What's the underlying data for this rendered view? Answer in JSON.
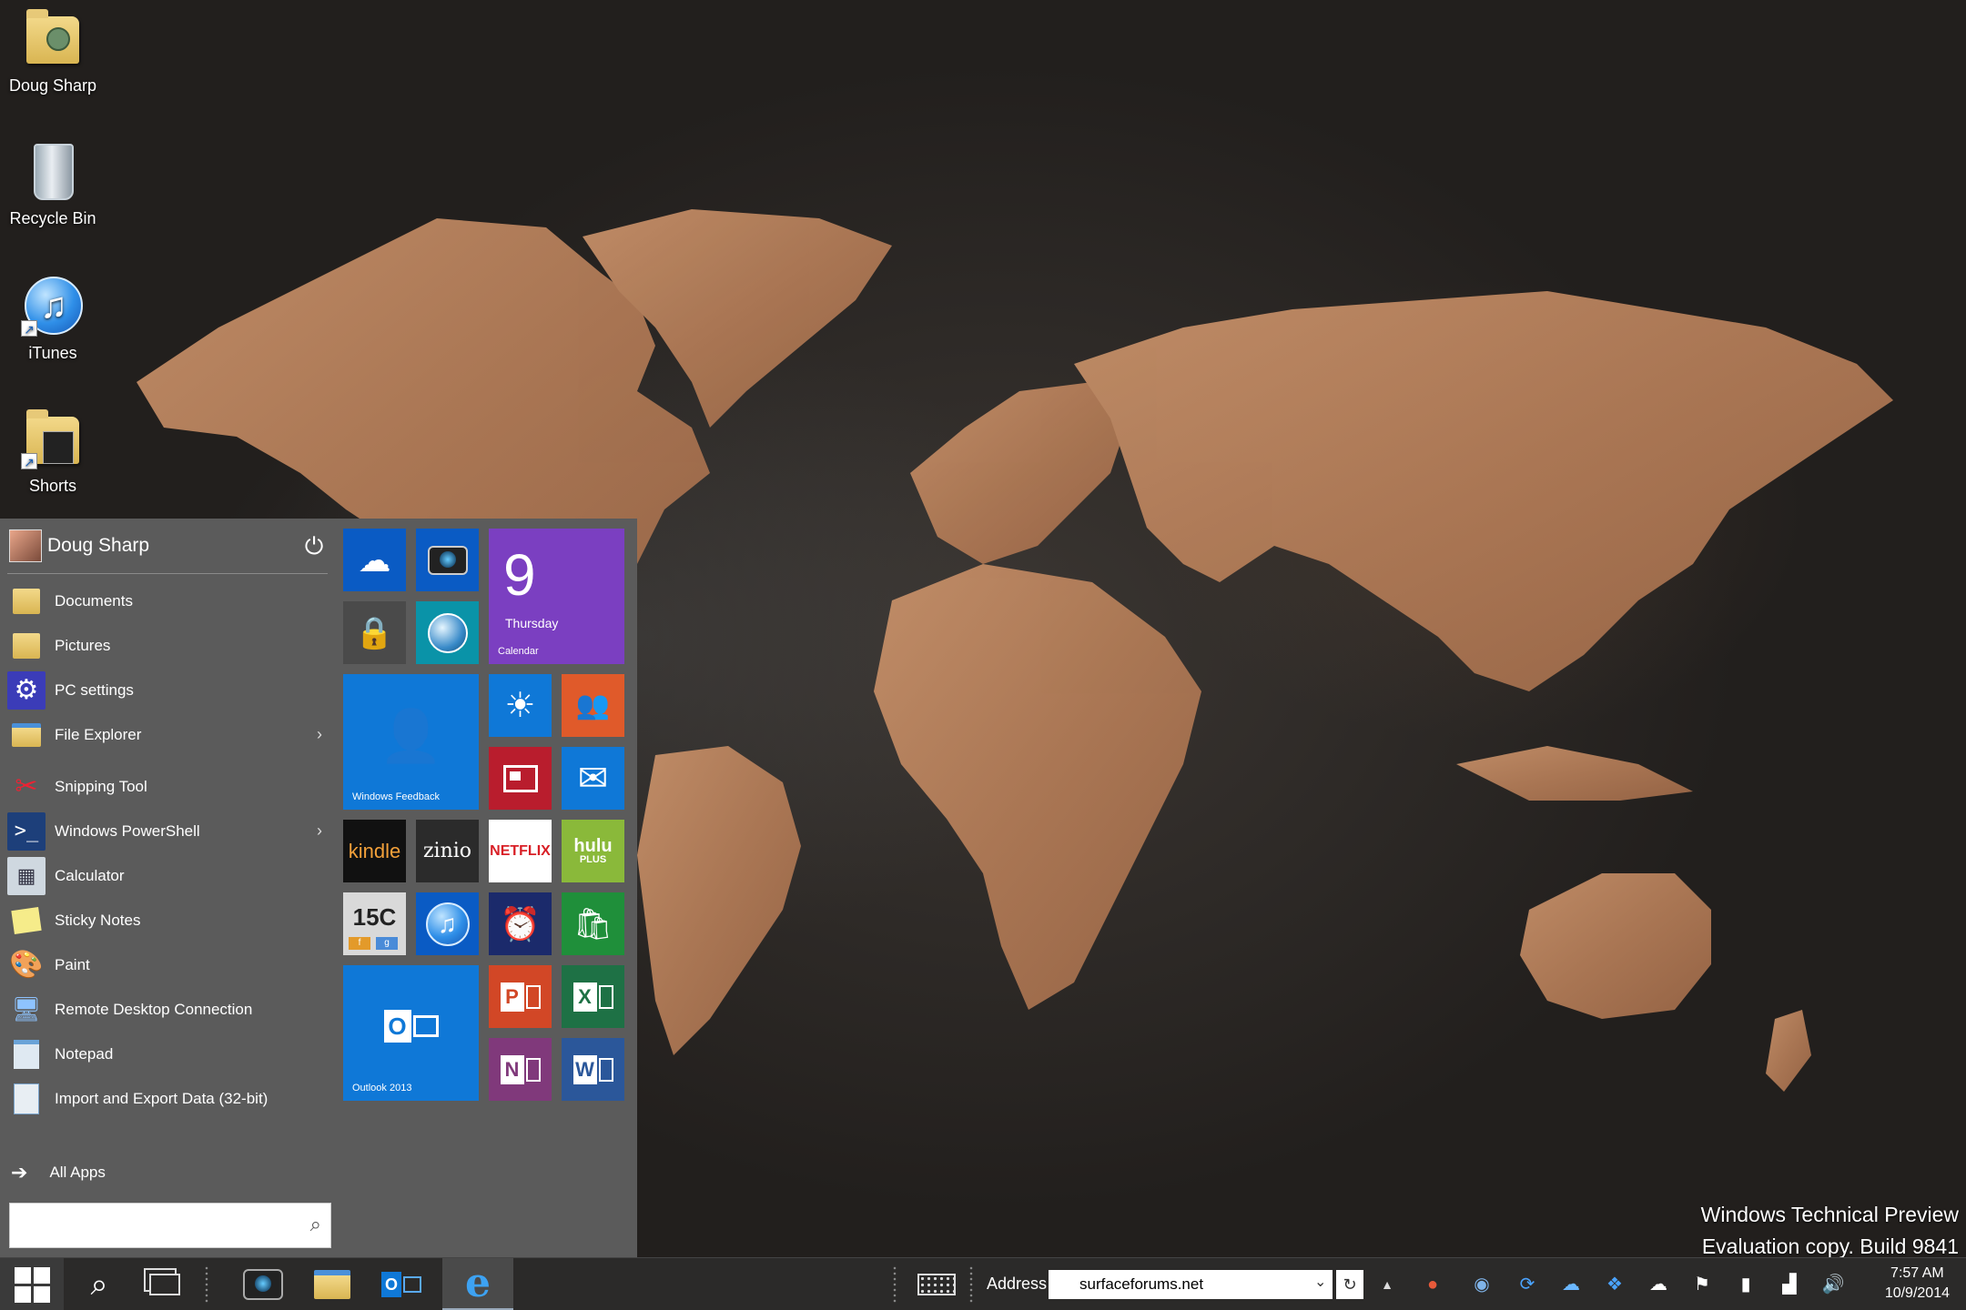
{
  "desktop": {
    "icons": [
      {
        "label": "Doug Sharp",
        "icon": "user-folder-icon"
      },
      {
        "label": "Recycle Bin",
        "icon": "recycle-bin-icon"
      },
      {
        "label": "iTunes",
        "icon": "itunes-icon"
      },
      {
        "label": "Shorts",
        "icon": "folder-shortcut-icon"
      }
    ],
    "watermark": {
      "line1": "Windows Technical Preview",
      "line2": "Evaluation copy. Build 9841"
    }
  },
  "start_menu": {
    "user_name": "Doug Sharp",
    "pinned": [
      {
        "label": "Documents",
        "icon": "documents-folder-icon"
      },
      {
        "label": "Pictures",
        "icon": "pictures-folder-icon"
      },
      {
        "label": "PC settings",
        "icon": "gear-icon"
      },
      {
        "label": "File Explorer",
        "icon": "file-explorer-icon",
        "has_submenu": true
      }
    ],
    "apps": [
      {
        "label": "Snipping Tool",
        "icon": "scissors-icon"
      },
      {
        "label": "Windows PowerShell",
        "icon": "powershell-icon",
        "has_submenu": true
      },
      {
        "label": "Calculator",
        "icon": "calculator-icon"
      },
      {
        "label": "Sticky Notes",
        "icon": "sticky-notes-icon"
      },
      {
        "label": "Paint",
        "icon": "paint-palette-icon"
      },
      {
        "label": "Remote Desktop Connection",
        "icon": "remote-desktop-icon"
      },
      {
        "label": "Notepad",
        "icon": "notepad-icon"
      },
      {
        "label": "Import and Export Data (32-bit)",
        "icon": "data-import-icon"
      }
    ],
    "all_apps_label": "All Apps",
    "search_value": "",
    "tiles": {
      "calendar": {
        "day": "9",
        "weekday": "Thursday",
        "label": "Calendar",
        "color": "#7b3fc1"
      },
      "windows_feedback": {
        "label": "Windows Feedback",
        "color": "#0f78d7"
      },
      "outlook": {
        "label": "Outlook 2013",
        "color": "#0f78d7"
      },
      "kindle": {
        "text": "kindle",
        "color": "#111111"
      },
      "zinio": {
        "text": "zinio",
        "color": "#2b2b2b"
      },
      "netflix": {
        "text": "NETFLIX",
        "color": "#ffffff"
      },
      "hulu": {
        "text": "hulu",
        "subtext": "PLUS",
        "color": "#8ab93a"
      },
      "fifteen_c": {
        "text": "15C",
        "sub_f": "f",
        "sub_g": "g"
      },
      "powerpoint": {
        "text": "P",
        "color": "#d24726"
      },
      "excel": {
        "text": "X",
        "color": "#1e7145"
      },
      "onenote": {
        "text": "N",
        "color": "#80397b"
      },
      "word": {
        "text": "W",
        "color": "#2b579a"
      }
    }
  },
  "taskbar": {
    "address_label": "Address",
    "address_value": "surfaceforums.net",
    "clock_time": "7:57 AM",
    "clock_date": "10/9/2014"
  }
}
